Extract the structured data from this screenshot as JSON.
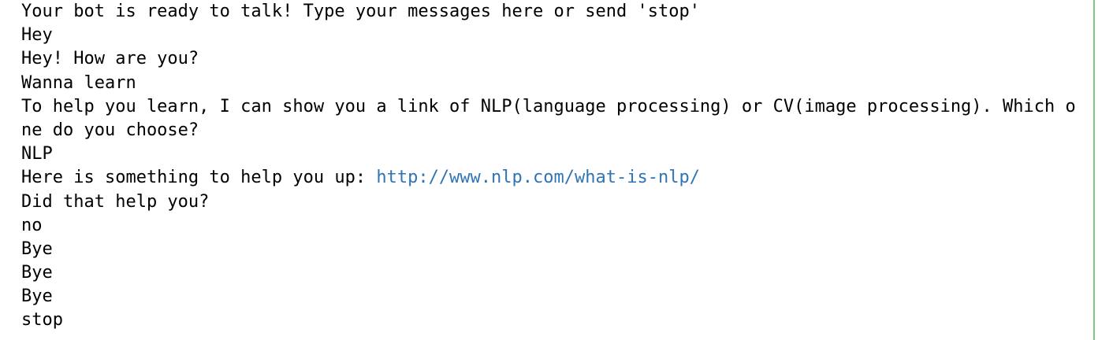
{
  "console": {
    "lines": [
      {
        "text": "Your bot is ready to talk! Type your messages here or send 'stop'"
      },
      {
        "text": "Hey"
      },
      {
        "text": "Hey! How are you?"
      },
      {
        "text": "Wanna learn"
      },
      {
        "text": "To help you learn, I can show you a link of NLP(language processing) or CV(image processing). Which one do you choose?"
      },
      {
        "text": "NLP"
      },
      {
        "text_prefix": "Here is something to help you up: ",
        "link": "http://www.nlp.com/what-is-nlp/"
      },
      {
        "text": "Did that help you?"
      },
      {
        "text": "no"
      },
      {
        "text": "Bye"
      },
      {
        "text": "Bye"
      },
      {
        "text": "Bye"
      },
      {
        "text": "stop"
      }
    ]
  },
  "colors": {
    "link": "#2f74b5",
    "border": "#7fc97f",
    "text": "#000000",
    "background": "#ffffff"
  }
}
